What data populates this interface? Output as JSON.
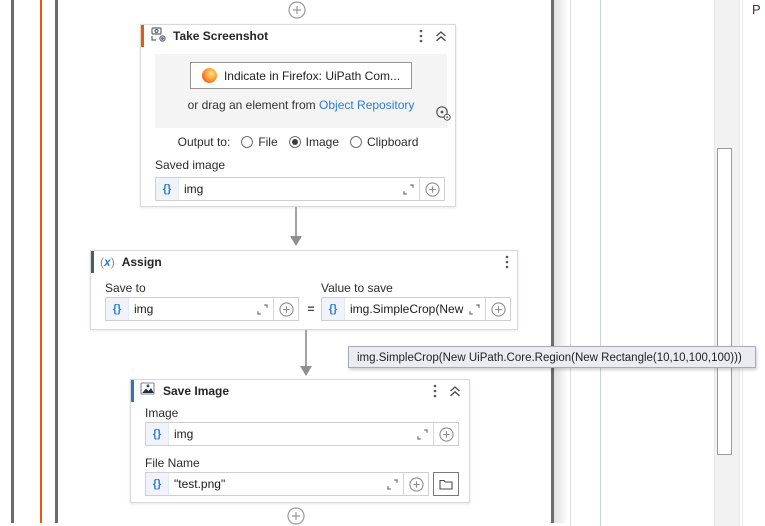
{
  "ui": {
    "braces": "{}"
  },
  "activities": {
    "take_screenshot": {
      "title": "Take Screenshot",
      "indicate_button_label": "Indicate in Firefox: UiPath Com...",
      "drag_prefix": "or drag an element from",
      "drag_link": "Object Repository",
      "output_label": "Output to:",
      "options": [
        {
          "label": "File",
          "selected": false
        },
        {
          "label": "Image",
          "selected": true
        },
        {
          "label": "Clipboard",
          "selected": false
        }
      ],
      "saved_image_label": "Saved image",
      "saved_image_value": "img"
    },
    "assign": {
      "icon_open": "(",
      "icon_x": "x",
      "icon_close": ")",
      "title": "Assign",
      "save_to_label": "Save to",
      "save_to_value": "img",
      "equals_sign": "=",
      "value_to_save_label": "Value to save",
      "value_to_save_value": "img.SimpleCrop(New UiPath.Core.Region(New Rectangle(10,10,100,100)))"
    },
    "save_image": {
      "title": "Save Image",
      "image_label": "Image",
      "image_value": "img",
      "file_name_label": "File Name",
      "file_name_value": "\"test.png\""
    }
  },
  "tooltip": {
    "text": "img.SimpleCrop(New UiPath.Core.Region(New Rectangle(10,10,100,100)))"
  },
  "properties_panel": {
    "partial_title": "P"
  },
  "colors": {
    "accent_orange": "#e8590c",
    "accent_slate": "#4f5b66",
    "accent_blue": "#2f74c0",
    "link_blue": "#2b7cd3"
  }
}
